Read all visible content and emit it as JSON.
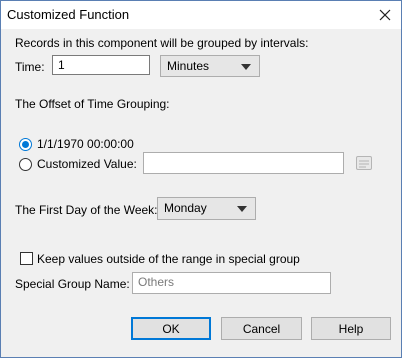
{
  "window": {
    "title": "Customized Function"
  },
  "intro": "Records in this component will be grouped by intervals:",
  "time": {
    "label": "Time:",
    "value": "1",
    "unit": "Minutes"
  },
  "offset": {
    "heading": "The Offset of Time Grouping:",
    "option_default": "1/1/1970 00:00:00",
    "option_custom": "Customized Value:",
    "selected": "default",
    "custom_value": ""
  },
  "first_day": {
    "label": "The First Day of the Week:",
    "value": "Monday"
  },
  "special": {
    "keep_label": "Keep values outside of the range in special group",
    "keep_checked": false,
    "name_label": "Special Group Name:",
    "name_value": "Others"
  },
  "buttons": {
    "ok": "OK",
    "cancel": "Cancel",
    "help": "Help"
  },
  "icons": {
    "close": "close-icon",
    "picker": "value-picker-icon"
  },
  "colors": {
    "accent": "#0078d7",
    "window_border": "#5a7fb3",
    "dialog_bg": "#f0f0f0"
  }
}
